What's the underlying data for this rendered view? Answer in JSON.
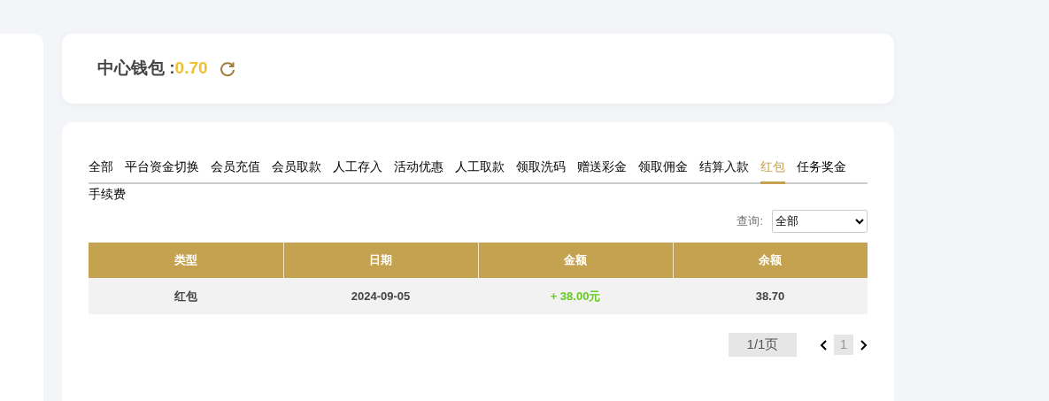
{
  "wallet": {
    "label": "中心钱包 :",
    "balance": "0.70"
  },
  "tabs": [
    {
      "label": "全部",
      "selected": false
    },
    {
      "label": "平台资金切换",
      "selected": false
    },
    {
      "label": "会员充值",
      "selected": false
    },
    {
      "label": "会员取款",
      "selected": false
    },
    {
      "label": "人工存入",
      "selected": false
    },
    {
      "label": "活动优惠",
      "selected": false
    },
    {
      "label": "人工取款",
      "selected": false
    },
    {
      "label": "领取洗码",
      "selected": false
    },
    {
      "label": "赠送彩金",
      "selected": false
    },
    {
      "label": "领取佣金",
      "selected": false
    },
    {
      "label": "结算入款",
      "selected": false
    },
    {
      "label": "红包",
      "selected": true
    },
    {
      "label": "任务奖金",
      "selected": false
    },
    {
      "label": "手续费",
      "selected": false
    }
  ],
  "filter": {
    "label": "查询:",
    "value": "全部"
  },
  "table": {
    "columns": [
      "类型",
      "日期",
      "金额",
      "余额"
    ],
    "rows": [
      {
        "type": "红包",
        "date": "2024-09-05",
        "amount": "+ 38.00元",
        "balance": "38.70"
      }
    ]
  },
  "pagination": {
    "pages": "1/1页",
    "current": "1"
  }
}
